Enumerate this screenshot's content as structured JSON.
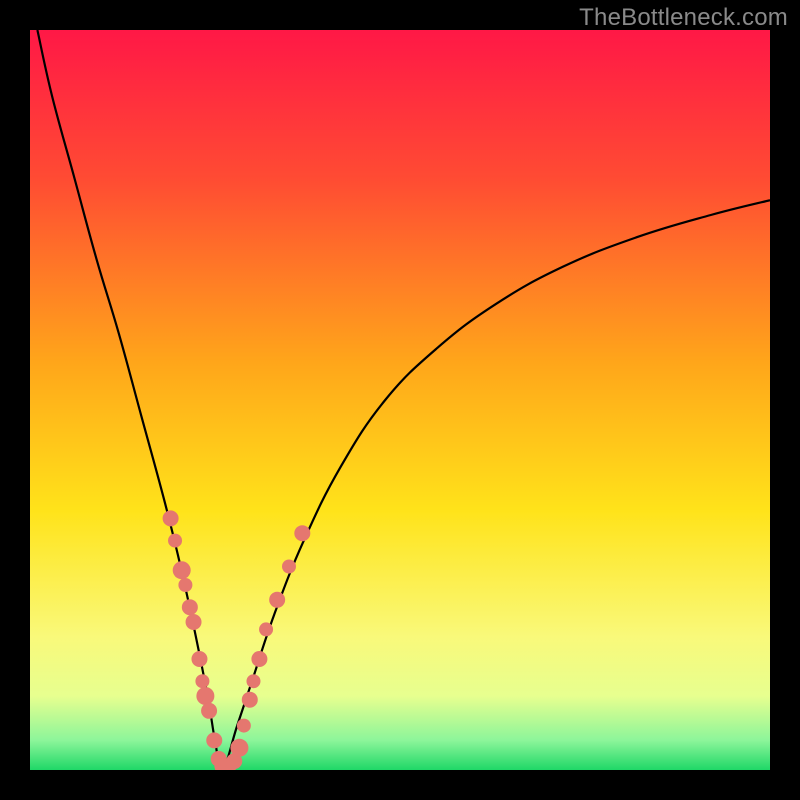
{
  "watermark": "TheBottleneck.com",
  "colors": {
    "black": "#000000",
    "curve": "#000000",
    "dot_fill": "#e5776f",
    "dot_stroke": "#d9635c"
  },
  "chart_data": {
    "type": "line",
    "title": "",
    "xlabel": "",
    "ylabel": "",
    "xlim": [
      0,
      100
    ],
    "ylim": [
      0,
      100
    ],
    "gradient_stops": [
      {
        "pct": 0,
        "color": "#ff1846"
      },
      {
        "pct": 20,
        "color": "#ff4b33"
      },
      {
        "pct": 45,
        "color": "#ffa61a"
      },
      {
        "pct": 65,
        "color": "#ffe31a"
      },
      {
        "pct": 82,
        "color": "#f9f97a"
      },
      {
        "pct": 90,
        "color": "#e7ff8f"
      },
      {
        "pct": 96,
        "color": "#8cf59a"
      },
      {
        "pct": 100,
        "color": "#1fd867"
      }
    ],
    "series": [
      {
        "name": "left-branch",
        "comment": "steep descent from top-left toward minimum near x≈26",
        "x": [
          1,
          3,
          6,
          9,
          12,
          15,
          18,
          20,
          22,
          24,
          25,
          26
        ],
        "y": [
          100,
          91,
          80,
          69,
          59,
          48,
          37,
          29,
          20,
          10,
          4,
          0
        ]
      },
      {
        "name": "right-branch",
        "comment": "rise from minimum, tapering off toward upper right",
        "x": [
          26,
          28,
          30,
          33,
          37,
          42,
          48,
          55,
          63,
          72,
          82,
          92,
          100
        ],
        "y": [
          0,
          6,
          12,
          21,
          31,
          41,
          50,
          57,
          63,
          68,
          72,
          75,
          77
        ]
      }
    ],
    "dots": {
      "comment": "pink sample points clustered around the minimum",
      "points": [
        {
          "x": 19.0,
          "y": 34,
          "r": 8
        },
        {
          "x": 19.6,
          "y": 31,
          "r": 7
        },
        {
          "x": 20.5,
          "y": 27,
          "r": 9
        },
        {
          "x": 21.0,
          "y": 25,
          "r": 7
        },
        {
          "x": 21.6,
          "y": 22,
          "r": 8
        },
        {
          "x": 22.1,
          "y": 20,
          "r": 8
        },
        {
          "x": 22.9,
          "y": 15,
          "r": 8
        },
        {
          "x": 23.3,
          "y": 12,
          "r": 7
        },
        {
          "x": 23.7,
          "y": 10,
          "r": 9
        },
        {
          "x": 24.2,
          "y": 8,
          "r": 8
        },
        {
          "x": 24.9,
          "y": 4,
          "r": 8
        },
        {
          "x": 25.5,
          "y": 1.5,
          "r": 8
        },
        {
          "x": 26.0,
          "y": 0.5,
          "r": 8
        },
        {
          "x": 26.8,
          "y": 0.5,
          "r": 8
        },
        {
          "x": 27.6,
          "y": 1.2,
          "r": 8
        },
        {
          "x": 28.3,
          "y": 3,
          "r": 9
        },
        {
          "x": 28.9,
          "y": 6,
          "r": 7
        },
        {
          "x": 29.7,
          "y": 9.5,
          "r": 8
        },
        {
          "x": 30.2,
          "y": 12,
          "r": 7
        },
        {
          "x": 31.0,
          "y": 15,
          "r": 8
        },
        {
          "x": 31.9,
          "y": 19,
          "r": 7
        },
        {
          "x": 33.4,
          "y": 23,
          "r": 8
        },
        {
          "x": 35.0,
          "y": 27.5,
          "r": 7
        },
        {
          "x": 36.8,
          "y": 32,
          "r": 8
        }
      ]
    }
  }
}
